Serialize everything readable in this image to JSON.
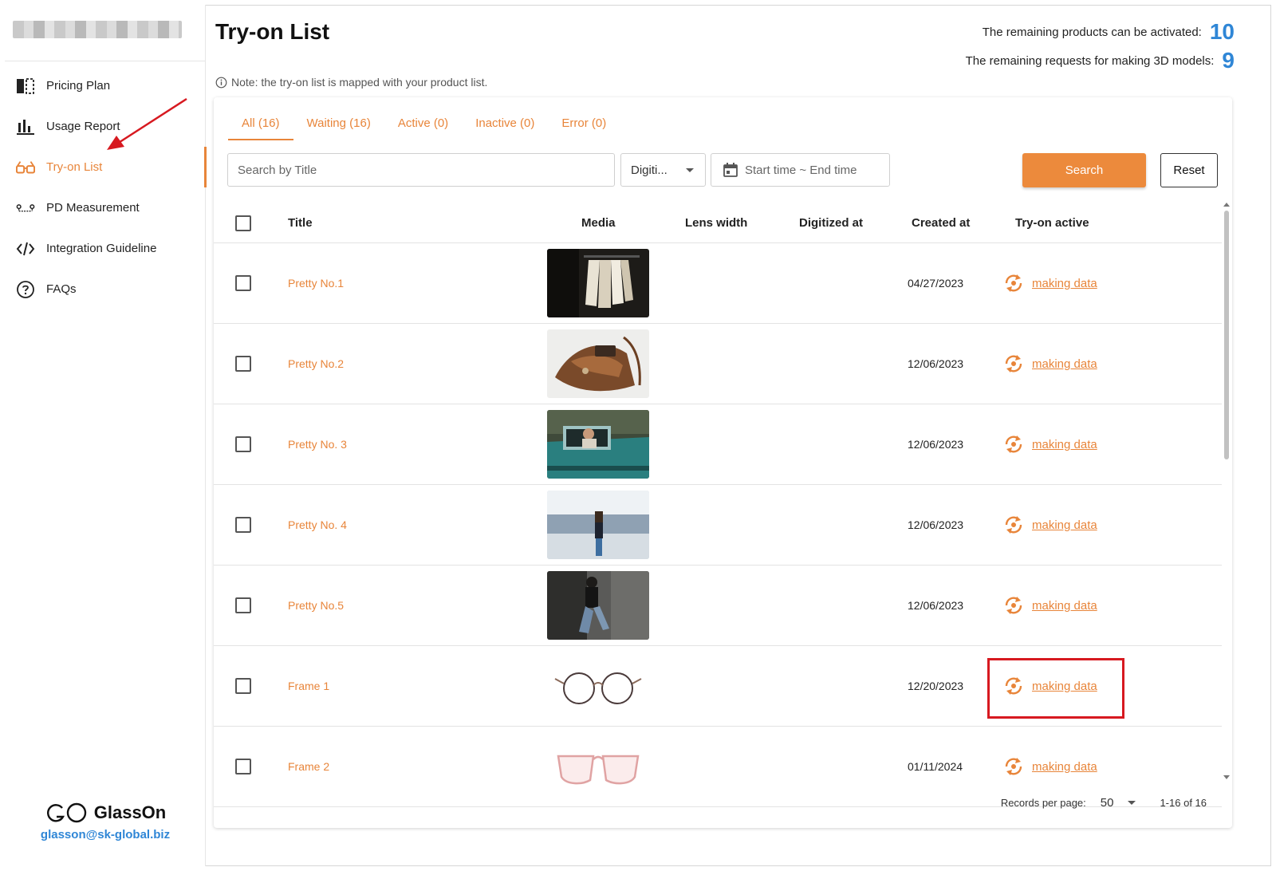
{
  "sidebar": {
    "items": [
      {
        "label": "Pricing Plan",
        "icon": "pricing-plan-icon"
      },
      {
        "label": "Usage Report",
        "icon": "bar-chart-icon"
      },
      {
        "label": "Try-on List",
        "icon": "glasses-icon",
        "active": true
      },
      {
        "label": "PD Measurement",
        "icon": "pd-measure-icon"
      },
      {
        "label": "Integration Guideline",
        "icon": "code-icon"
      },
      {
        "label": "FAQs",
        "icon": "question-circle-icon"
      }
    ],
    "footer": {
      "brand": "GlassOn",
      "email": "glasson@sk-global.biz"
    }
  },
  "header": {
    "title": "Try-on List",
    "note": "Note: the try-on list is mapped with your product list.",
    "stats": [
      {
        "label": "The remaining products can be activated:",
        "value": "10"
      },
      {
        "label": "The remaining requests for making 3D models:",
        "value": "9"
      }
    ]
  },
  "tabs": [
    {
      "label": "All (16)",
      "active": true
    },
    {
      "label": "Waiting (16)"
    },
    {
      "label": "Active (0)"
    },
    {
      "label": "Inactive (0)"
    },
    {
      "label": "Error (0)"
    }
  ],
  "filters": {
    "search_placeholder": "Search by Title",
    "select_value": "Digiti...",
    "date_placeholder": "Start time ~ End time",
    "search_label": "Search",
    "reset_label": "Reset"
  },
  "table": {
    "columns": [
      "Title",
      "Media",
      "Lens width",
      "Digitized at",
      "Created at",
      "Try-on active"
    ],
    "rows": [
      {
        "title": "Pretty No.1",
        "media": "clothes-rack-photo",
        "lens_width": "",
        "digitized_at": "",
        "created_at": "04/27/2023",
        "status": "making data"
      },
      {
        "title": "Pretty No.2",
        "media": "leather-bag-photo",
        "lens_width": "",
        "digitized_at": "",
        "created_at": "12/06/2023",
        "status": "making data"
      },
      {
        "title": "Pretty No. 3",
        "media": "woman-in-truck-photo",
        "lens_width": "",
        "digitized_at": "",
        "created_at": "12/06/2023",
        "status": "making data"
      },
      {
        "title": "Pretty No. 4",
        "media": "woman-on-street-photo",
        "lens_width": "",
        "digitized_at": "",
        "created_at": "12/06/2023",
        "status": "making data"
      },
      {
        "title": "Pretty No.5",
        "media": "woman-seated-photo",
        "lens_width": "",
        "digitized_at": "",
        "created_at": "12/06/2023",
        "status": "making data"
      },
      {
        "title": "Frame 1",
        "media": "round-glasses-photo",
        "lens_width": "",
        "digitized_at": "",
        "created_at": "12/20/2023",
        "status": "making data",
        "highlighted": true
      },
      {
        "title": "Frame 2",
        "media": "pink-glasses-photo",
        "lens_width": "",
        "digitized_at": "",
        "created_at": "01/11/2024",
        "status": "making data"
      }
    ]
  },
  "pagination": {
    "label": "Records per page:",
    "per_page": "50",
    "range": "1-16 of 16"
  },
  "colors": {
    "accent": "#e8853a",
    "button": "#ec8a3c",
    "link_blue": "#2f86d6",
    "highlight": "#d71920"
  }
}
